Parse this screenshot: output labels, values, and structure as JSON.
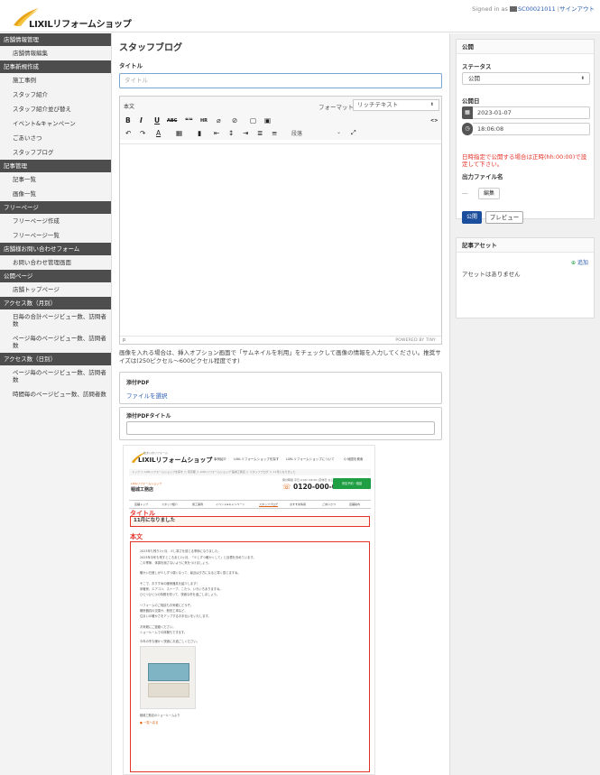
{
  "app": {
    "brand": "LIXILリフォームショップ",
    "signed_in_label": "Signed in as",
    "user_id": "SC00021011",
    "separator": "|",
    "signout": "サインアウト",
    "accent_color": "#1b4e9c",
    "warning_color": "#e5332a"
  },
  "sidebar": {
    "sections": [
      {
        "title": "店舗情報管理",
        "items": [
          "店舗情報編集"
        ]
      },
      {
        "title": "記事新規作成",
        "items": [
          "施工事例",
          "スタッフ紹介",
          "スタッフ紹介並び替え",
          "イベント&キャンペーン",
          "ごあいさつ",
          "スタッフブログ"
        ]
      },
      {
        "title": "記事管理",
        "items": [
          "記事一覧",
          "画像一覧"
        ]
      },
      {
        "title": "フリーページ",
        "items": [
          "フリーページ作成",
          "フリーページ一覧"
        ]
      },
      {
        "title": "店舗様お問い合わせフォーム",
        "items": [
          "お問い合わせ管理画面"
        ]
      },
      {
        "title": "公開ページ",
        "items": [
          "店舗トップページ"
        ]
      },
      {
        "title": "アクセス数（月別）",
        "items": [
          "日毎の合計ページビュー数、訪問者数",
          "ページ毎のページビュー数、訪問者数"
        ]
      },
      {
        "title": "アクセス数（日別）",
        "items": [
          "ページ毎のページビュー数、訪問者数",
          "時間毎のページビュー数、訪問者数"
        ]
      }
    ]
  },
  "main": {
    "page_title": "スタッフブログ",
    "title_label": "タイトル",
    "title_placeholder": "タイトル",
    "editor": {
      "tab": "本文",
      "format_label": "フォーマット",
      "format_value": "リッチテキスト",
      "paragraph": "段落",
      "status_path": "p",
      "powered_by": "POWERED BY TINY",
      "toolbar_row1": [
        "B",
        "I",
        "U",
        "ABC",
        "❝❝",
        "HR",
        "⌀",
        "⊘",
        "▢",
        "▣"
      ],
      "toolbar_source": "<>",
      "toolbar_row2": [
        "↶",
        "↷",
        "A",
        "▦",
        "▮",
        "⇤",
        "↕",
        "⇥",
        "≣",
        "≡"
      ]
    },
    "note": "画像を入れる場合は、挿入オプション画面で「サムネイルを利用」をチェックして画像の情報を入力してください。推奨サイズは(250ピクセル〜600ピクセル程度です)",
    "pdf": {
      "label": "添付PDF",
      "link": "ファイルを選択"
    },
    "pdf_title": {
      "label": "添付PDFタイトル",
      "value": ""
    }
  },
  "preview": {
    "logo_sub": "住まいのリフォーム",
    "logo": "LIXILリフォームショップ",
    "nav": [
      "事例紹介",
      "LIXILリフォームショップを探す",
      "LIXILリフォームショップについて",
      "Q 地図を検索"
    ],
    "crumb": "トップ ＞ LIXILリフォームショップを探す ＞ 東京都 ＞ LIXILリフォームショップ 稲城工務店 ＞ スタッフブログ ＞ 11月になりました",
    "shop_sub": "LIXILリフォームショップ",
    "shop": "稲城工務店",
    "tel_sub": "受付時間 平日 9:00〜18:00 (定休日 なし)",
    "tel": "0120-000-000",
    "green_btn": "来店予約・相談",
    "menu": [
      "店舗トップ",
      "スタッフ紹介",
      "施工事例",
      "イベント&キャンペーン",
      "スタッフブログ",
      "おすすめ情報",
      "ごあいさつ",
      "店舗案内"
    ],
    "label_title": "タイトル",
    "title_value": "11月になりました",
    "label_body": "本文",
    "body_lines": [
      "2023年も残り2ヶ月、少し寒さを感じる季節になりました。",
      "2023年今年も残すところあと2ヶ月、「少しずつ暖かくして」と目標を決めています。",
      "この季節、体調を崩さないように気をつけましょう。",
      "",
      "暖かい日差しが少しずつ弱くなって、最近は夕方になると寒く感じますね。",
      "",
      "そこで、おすすめの暖房器具を紹介します！",
      "床暖房、エアコン、ストーブ、こたつ、いろいろありますね。",
      "ひとつひとつの特徴を知って、快適な冬を過ごしましょう。",
      "",
      "リフォームのご相談もお気軽にどうぞ。",
      "暖房器具の交換や、断熱工事など、",
      "住まいの暖かさをアップするお手伝いをいたします。",
      "",
      "お気軽にご連絡ください。",
      "ショールームでの体験もできます。",
      "",
      "今年の冬も暖かく快適にお過ごしください。"
    ],
    "caption": "稲城工務店のショールームより",
    "back": "一覧へ戻る"
  },
  "rpanel": {
    "publish_title": "公開",
    "status_label": "ステータス",
    "status_value": "公開",
    "date_label": "公開日",
    "date_value": "2023-01-07",
    "time_value": "18:06:08",
    "warning": "日時指定で公開する場合は正時(hh:00:00)で設定して下さい。",
    "output_label": "出力ファイル名",
    "output_dash": "―",
    "edit_btn": "編集",
    "publish_btn": "公開",
    "preview_btn": "プレビュー",
    "asset_title": "記事アセット",
    "add_label": "追加",
    "no_assets": "アセットはありません"
  }
}
